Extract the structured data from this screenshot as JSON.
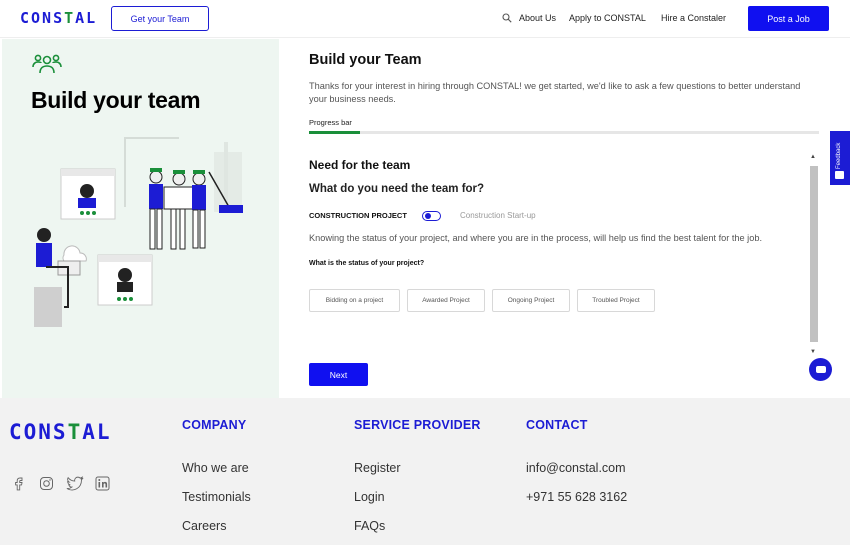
{
  "header": {
    "logo": "CONSTAL",
    "get_team_label": "Get your Team",
    "nav": [
      "About Us",
      "Apply to CONSTAL",
      "Hire a Constaler"
    ],
    "post_job_label": "Post a Job"
  },
  "left": {
    "title": "Build your team"
  },
  "main": {
    "title": "Build your Team",
    "intro": "Thanks for your interest in hiring through CONSTAL! we get started, we'd like to ask a few questions to better understand your business needs.",
    "progress_label": "Progress bar",
    "progress_fraction": 0.1,
    "section_title": "Need for the team",
    "question": "What do you need the team for?",
    "toggle_left": "CONSTRUCTION PROJECT",
    "toggle_right": "Construction Start-up",
    "knowing_text": "Knowing the status of your project, and where you are in the process, will help us find the best talent for the job.",
    "status_question": "What is the status of your project?",
    "options": [
      "Bidding on a project",
      "Awarded Project",
      "Ongoing Project",
      "Troubled Project"
    ],
    "next_label": "Next"
  },
  "feedback_label": "Feedback",
  "footer": {
    "logo": "CONSTAL",
    "company": {
      "heading": "COMPANY",
      "links": [
        "Who we are",
        "Testimonials",
        "Careers"
      ]
    },
    "service": {
      "heading": "SERVICE PROVIDER",
      "links": [
        "Register",
        "Login",
        "FAQs"
      ]
    },
    "contact": {
      "heading": "CONTACT",
      "links": [
        "info@constal.com",
        "+971 55 628 3162"
      ]
    },
    "social_icons": [
      "facebook-icon",
      "instagram-icon",
      "twitter-icon",
      "linkedin-icon"
    ]
  },
  "colors": {
    "brand_blue": "#1c1cd4",
    "button_blue": "#1010f0",
    "brand_green": "#1a8f3a",
    "panel_bg": "#eef6f1",
    "footer_bg": "#f2f2f2"
  }
}
